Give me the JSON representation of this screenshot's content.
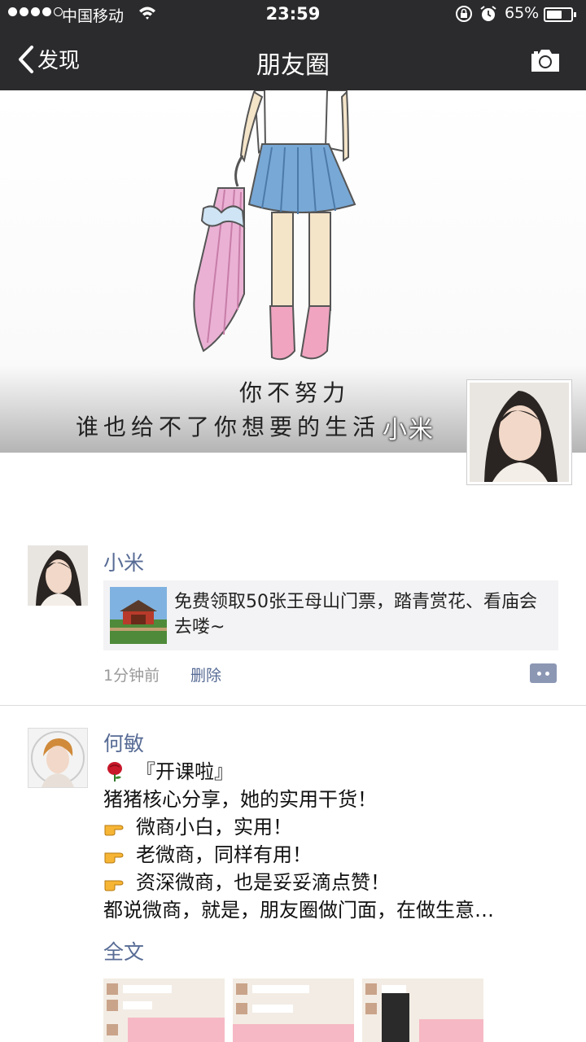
{
  "status_bar": {
    "carrier": "中国移动",
    "time": "23:59",
    "battery_percent": "65%",
    "battery_level": 0.65,
    "icons": [
      "signal-dots-icon",
      "wifi-icon",
      "rotation-lock-icon",
      "alarm-icon",
      "battery-icon"
    ]
  },
  "nav": {
    "back_label": "发现",
    "title": "朋友圈",
    "camera_icon": "camera-icon"
  },
  "cover": {
    "line1": "你不努力",
    "line2": "谁也给不了你想要的生活",
    "owner_name": "小米"
  },
  "posts": [
    {
      "author": "小米",
      "link_text": "免费领取50张王母山门票，踏青赏花、看庙会去喽~",
      "time": "1分钟前",
      "delete_label": "删除"
    },
    {
      "author": "何敏",
      "lines": [
        "『开课啦』",
        "猪猪核心分享，她的实用干货！",
        "微商小白，实用！",
        " 老微商，同样有用！",
        " 资深微商，也是妥妥滴点赞！",
        "都说微商，就是，朋友圈做门面，在做生意…"
      ],
      "full_text_label": "全文"
    }
  ],
  "colors": {
    "nav_bg": "#2b2b2d",
    "link_blue": "#576b95",
    "meta_gray": "#9a9a9a",
    "card_bg": "#f3f3f5"
  }
}
